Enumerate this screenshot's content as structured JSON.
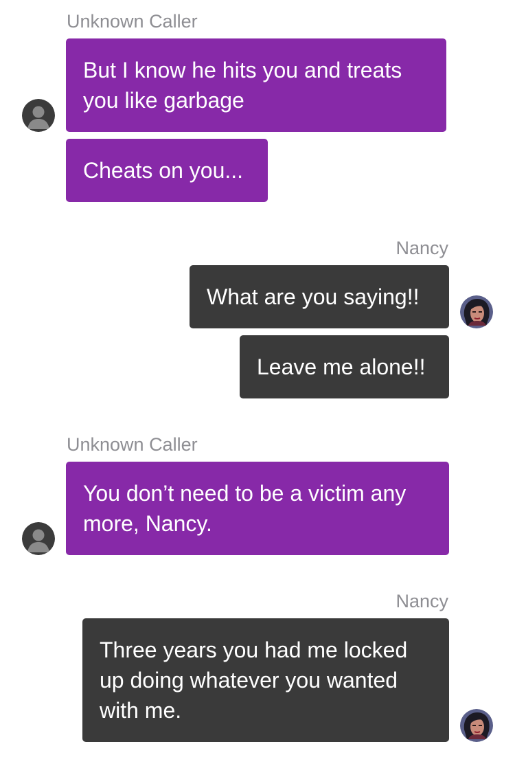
{
  "conversation": {
    "groups": [
      {
        "sender": "Unknown Caller",
        "direction": "incoming",
        "avatar_icon": "default-user-avatar-icon",
        "messages": [
          "But I know he hits you and treats you like garbage",
          "Cheats on you..."
        ]
      },
      {
        "sender": "Nancy",
        "direction": "outgoing",
        "avatar_icon": "nancy-avatar-icon",
        "messages": [
          "What are you saying!!",
          "Leave me alone!!"
        ]
      },
      {
        "sender": "Unknown Caller",
        "direction": "incoming",
        "avatar_icon": "default-user-avatar-icon",
        "messages": [
          "You don’t need to be a victim any more, Nancy."
        ]
      },
      {
        "sender": "Nancy",
        "direction": "outgoing",
        "avatar_icon": "nancy-avatar-icon",
        "messages": [
          "Three years you had me locked up doing whatever you wanted with me."
        ]
      }
    ]
  },
  "colors": {
    "incoming_bubble": "#8729a8",
    "outgoing_bubble": "#3a3a3a",
    "sender_name": "#8e8e93",
    "background": "#ffffff"
  }
}
